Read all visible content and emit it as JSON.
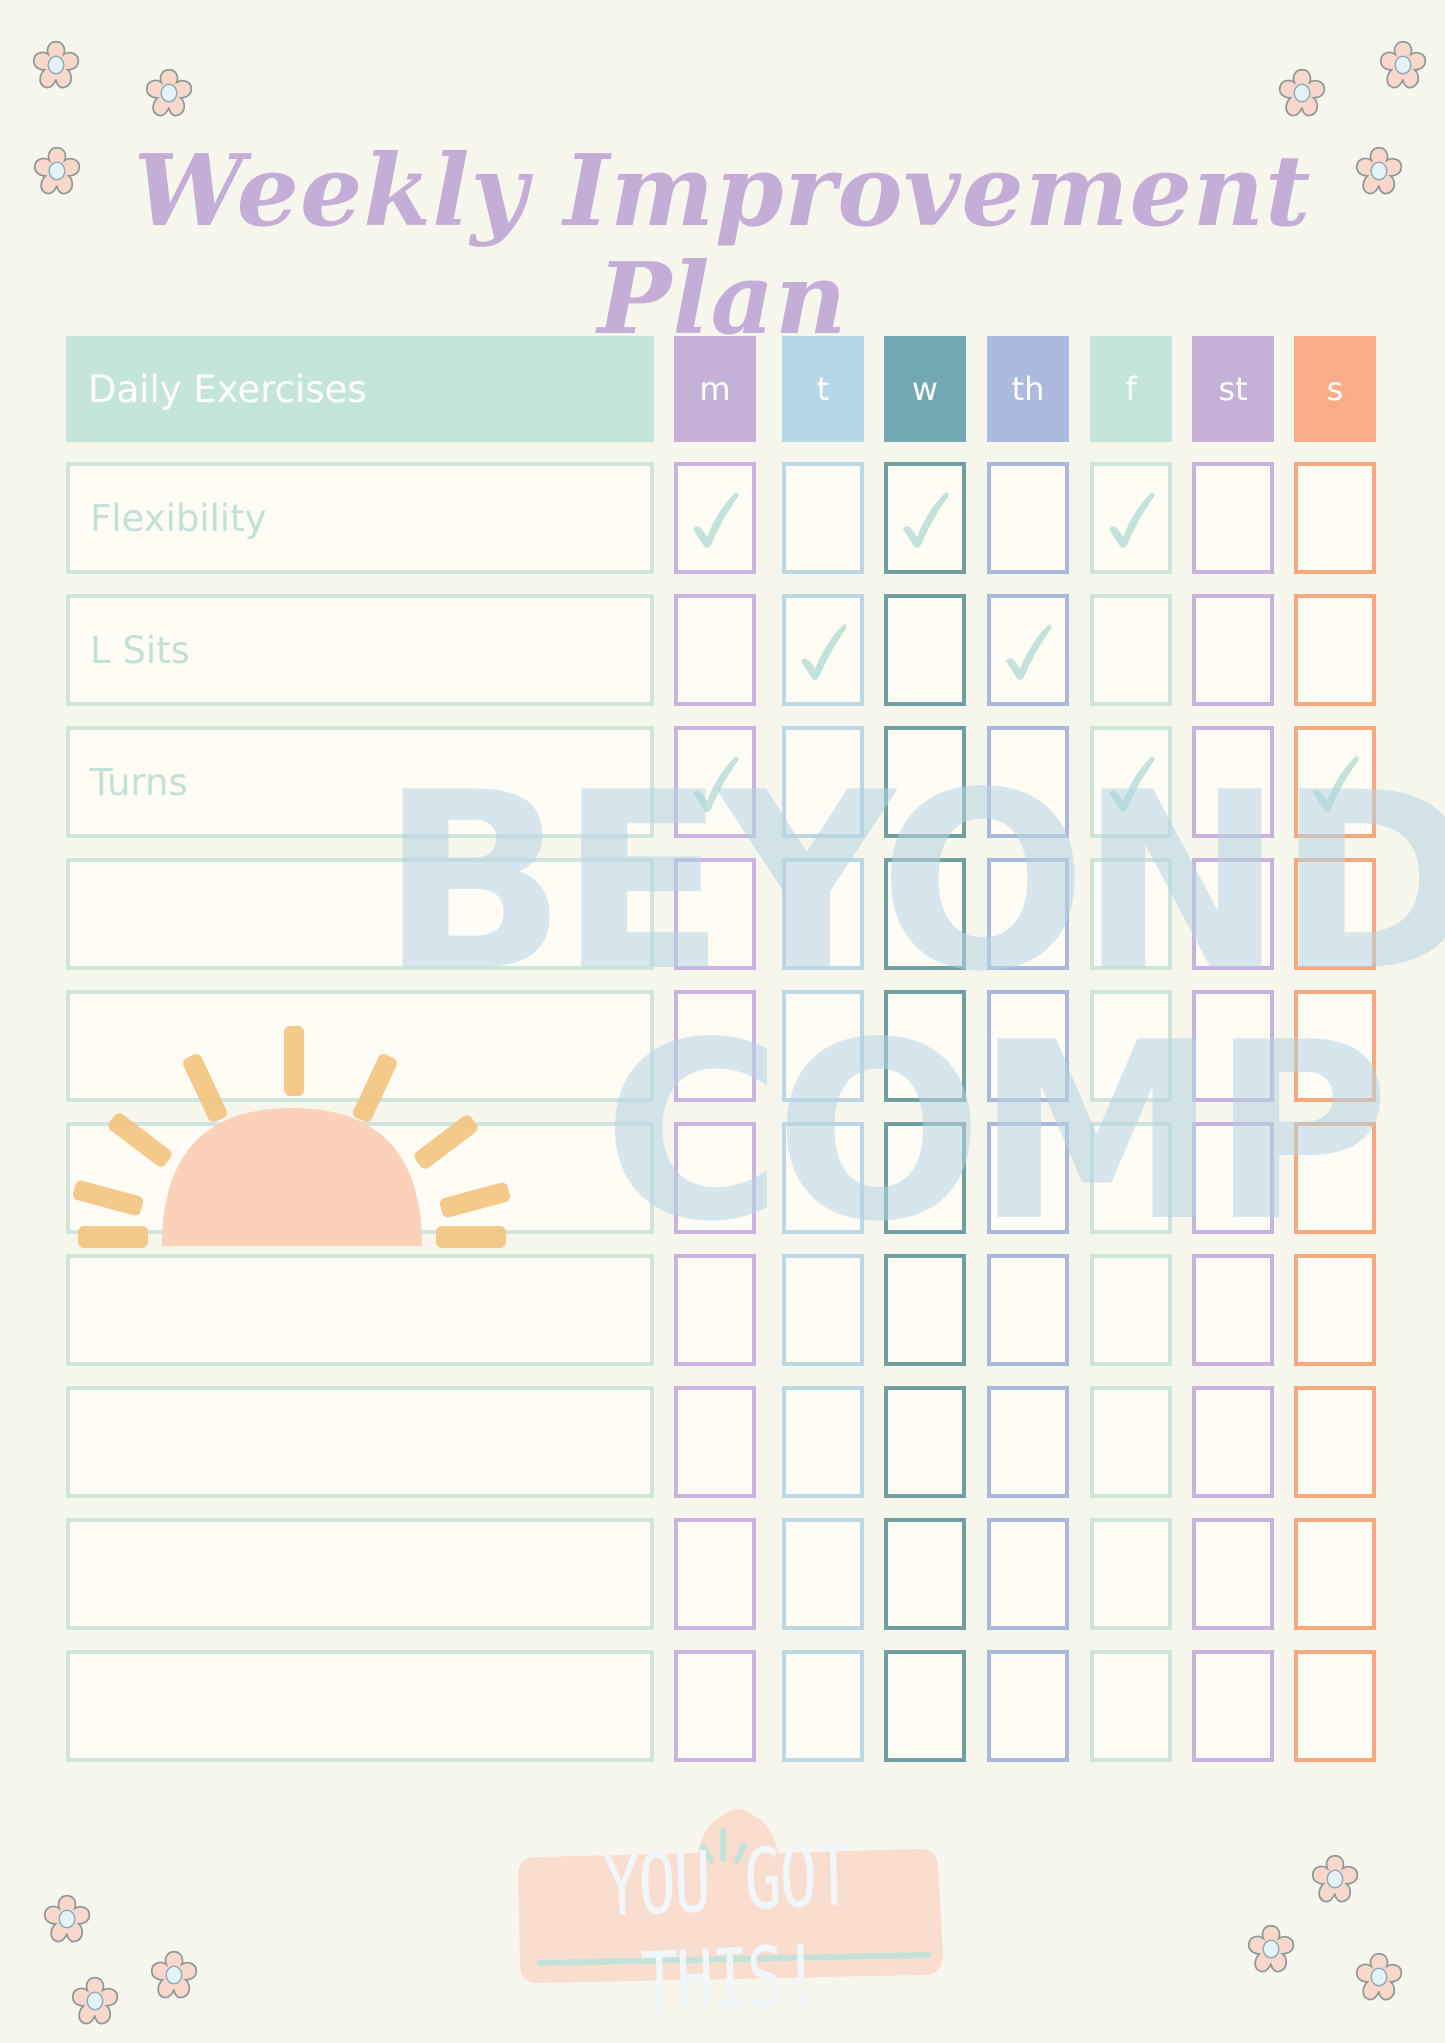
{
  "title": "Weekly Improvement Plan",
  "table": {
    "label_header": "Daily Exercises",
    "days": [
      {
        "label": "m",
        "color": "#c5b0d7",
        "border": "#c9b3e0"
      },
      {
        "label": "t",
        "color": "#b6d7e8",
        "border": "#bad7e3"
      },
      {
        "label": "w",
        "color": "#71a8b1",
        "border": "#6f9fa0"
      },
      {
        "label": "th",
        "color": "#acbadf",
        "border": "#aab8dc"
      },
      {
        "label": "f",
        "color": "#c5e4db",
        "border": "#cde4da"
      },
      {
        "label": "st",
        "color": "#c5b0d7",
        "border": "#c6b2dc"
      },
      {
        "label": "s",
        "color": "#f8ad88",
        "border": "#f5a97f"
      }
    ],
    "rows": [
      {
        "exercise": "Flexibility",
        "checks": [
          true,
          false,
          true,
          false,
          true,
          false,
          false
        ]
      },
      {
        "exercise": "L Sits",
        "checks": [
          false,
          true,
          false,
          true,
          false,
          false,
          false
        ]
      },
      {
        "exercise": "Turns",
        "checks": [
          true,
          false,
          false,
          false,
          true,
          false,
          true
        ]
      },
      {
        "exercise": "",
        "checks": [
          false,
          false,
          false,
          false,
          false,
          false,
          false
        ]
      },
      {
        "exercise": "",
        "checks": [
          false,
          false,
          false,
          false,
          false,
          false,
          false
        ]
      },
      {
        "exercise": "",
        "checks": [
          false,
          false,
          false,
          false,
          false,
          false,
          false
        ]
      },
      {
        "exercise": "",
        "checks": [
          false,
          false,
          false,
          false,
          false,
          false,
          false
        ]
      },
      {
        "exercise": "",
        "checks": [
          false,
          false,
          false,
          false,
          false,
          false,
          false
        ]
      },
      {
        "exercise": "",
        "checks": [
          false,
          false,
          false,
          false,
          false,
          false,
          false
        ]
      },
      {
        "exercise": "",
        "checks": [
          false,
          false,
          false,
          false,
          false,
          false,
          false
        ]
      }
    ],
    "check_color": "#c2e2da"
  },
  "watermark": {
    "line1": "BEYOND",
    "line2": "COMP"
  },
  "sticker": {
    "text": "YOU GOT THIS!"
  },
  "decor": {
    "flower_icon": "flower-icon",
    "sun_icon": "sunrise-icon"
  }
}
